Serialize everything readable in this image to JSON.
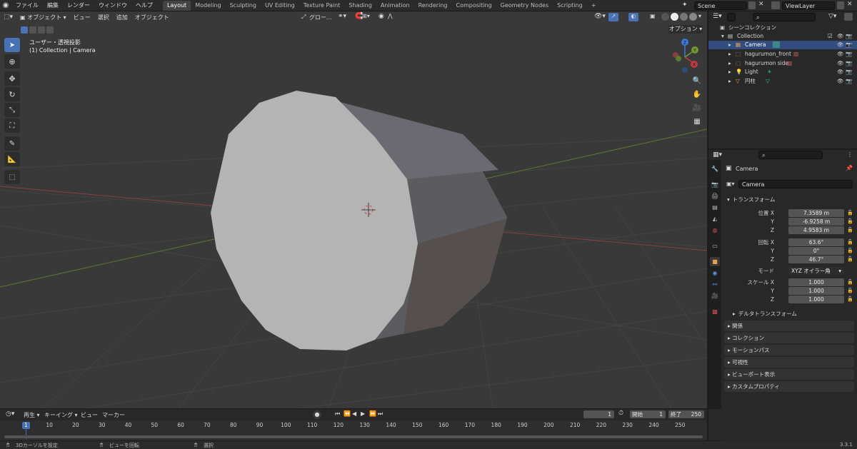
{
  "menubar": {
    "items": [
      "ファイル",
      "編集",
      "レンダー",
      "ウィンドウ",
      "ヘルプ"
    ],
    "workspaces": [
      "Layout",
      "Modeling",
      "Sculpting",
      "UV Editing",
      "Texture Paint",
      "Shading",
      "Animation",
      "Rendering",
      "Compositing",
      "Geometry Nodes",
      "Scripting"
    ],
    "active_workspace": "Layout",
    "add_tab": "+",
    "scene": "Scene",
    "view_layer": "ViewLayer"
  },
  "viewport": {
    "mode": "オブジェクト",
    "menus": [
      "ビュー",
      "選択",
      "追加",
      "オブジェクト"
    ],
    "transform_orientation": "グロー...",
    "options_label": "オプション",
    "view_name": "ユーザー・透視投影",
    "view_collection": "(1) Collection | Camera",
    "gizmo_axes": [
      "X",
      "Y",
      "Z"
    ]
  },
  "outliner": {
    "header": "シーンコレクション",
    "rows": [
      {
        "label": "Collection",
        "indent": 1
      },
      {
        "label": "Camera",
        "indent": 2,
        "selected": true
      },
      {
        "label": "hagurumon_front",
        "indent": 2
      },
      {
        "label": "hagurumon side",
        "indent": 2
      },
      {
        "label": "Light",
        "indent": 2
      },
      {
        "label": "円柱",
        "indent": 2
      }
    ]
  },
  "properties": {
    "object_header": "Camera",
    "object_name": "Camera",
    "transform_title": "トランスフォーム",
    "location_label": "位置 X",
    "location": {
      "x": "7.3589 m",
      "y": "-6.9258 m",
      "z": "4.9583 m"
    },
    "rotation_label": "回転 X",
    "rotation": {
      "x": "63.6°",
      "y": "0°",
      "z": "46.7°"
    },
    "mode_label": "モード",
    "mode_value": "XYZ オイラー角",
    "scale_label": "スケール X",
    "scale": {
      "x": "1.000",
      "y": "1.000",
      "z": "1.000"
    },
    "axis_y": "Y",
    "axis_z": "Z",
    "delta_transform": "デルタトランスフォーム",
    "panels": [
      "関係",
      "コレクション",
      "モーションパス",
      "可視性",
      "ビューポート表示",
      "カスタムプロパティ"
    ]
  },
  "timeline": {
    "menus": [
      "再生",
      "キーイング",
      "ビュー",
      "マーカー"
    ],
    "current_frame": "1",
    "start_label": "開始",
    "start": "1",
    "end_label": "終了",
    "end": "250",
    "ticks": [
      "10",
      "20",
      "30",
      "40",
      "50",
      "60",
      "70",
      "80",
      "90",
      "100",
      "110",
      "120",
      "130",
      "140",
      "150",
      "160",
      "170",
      "180",
      "190",
      "200",
      "210",
      "220",
      "230",
      "240",
      "250"
    ],
    "playhead": "1"
  },
  "statusbar": {
    "left": "3Dカーソルを設定",
    "middle": "ビューを回転",
    "right": "選択",
    "version": "3.3.1"
  },
  "colors": {
    "accent": "#4772b3",
    "selection": "#334d80",
    "x_axis": "#c4383d",
    "y_axis": "#6e9a2e",
    "z_axis": "#3c78d8"
  }
}
